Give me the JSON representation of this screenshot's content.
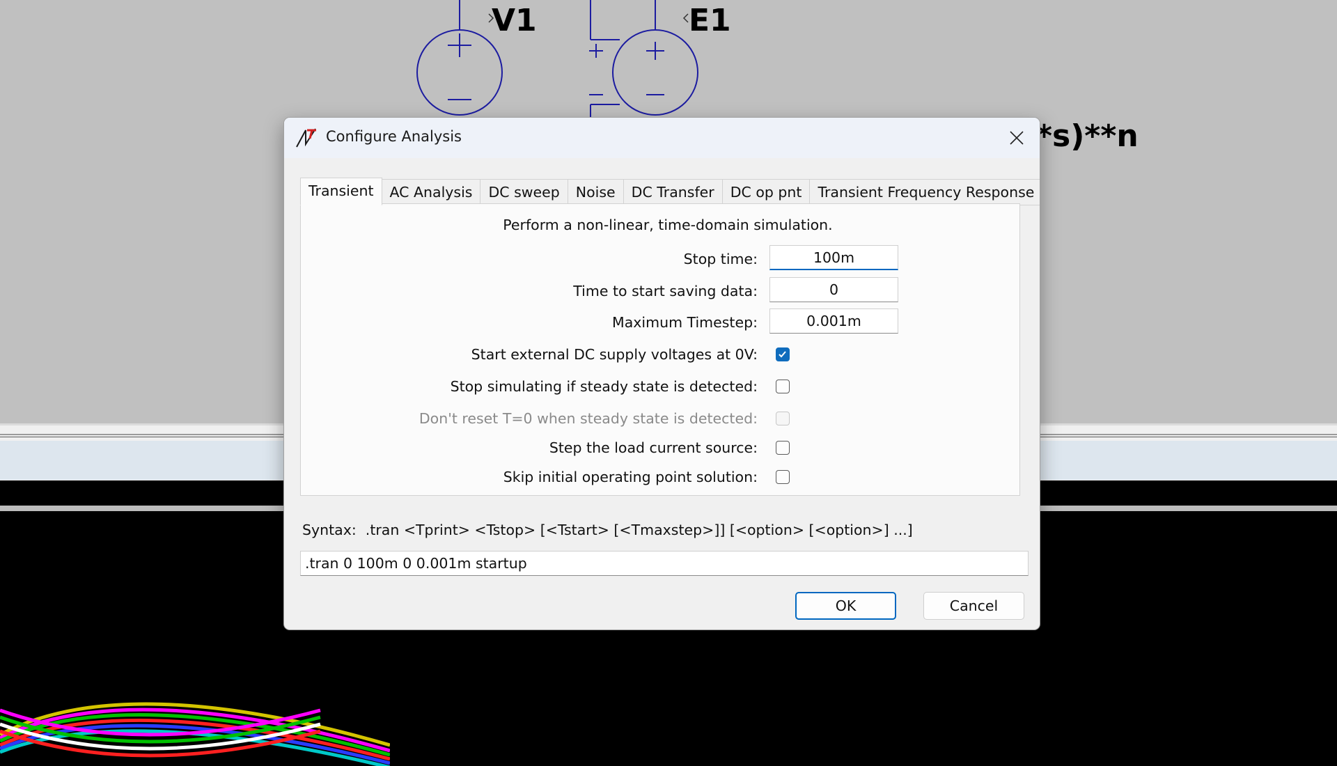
{
  "schematic": {
    "v1_label": "V1",
    "e1_label": "E1",
    "expr_fragment": "*s)**n"
  },
  "dialog": {
    "title": "Configure Analysis",
    "tabs": [
      {
        "label": "Transient"
      },
      {
        "label": "AC Analysis"
      },
      {
        "label": "DC sweep"
      },
      {
        "label": "Noise"
      },
      {
        "label": "DC Transfer"
      },
      {
        "label": "DC op pnt"
      },
      {
        "label": "Transient Frequency Response"
      }
    ],
    "active_tab": "Transient",
    "transient": {
      "description": "Perform a non-linear, time-domain simulation.",
      "stop_time_label": "Stop time:",
      "stop_time_value": "100m",
      "start_saving_label": "Time to start saving data:",
      "start_saving_value": "0",
      "max_timestep_label": "Maximum Timestep:",
      "max_timestep_value": "0.001m",
      "options": [
        {
          "label": "Start external DC supply voltages at 0V:",
          "checked": true,
          "enabled": true
        },
        {
          "label": "Stop simulating if steady state is detected:",
          "checked": false,
          "enabled": true
        },
        {
          "label": "Don't reset T=0 when steady state is detected:",
          "checked": false,
          "enabled": false
        },
        {
          "label": "Step the load current source:",
          "checked": false,
          "enabled": true
        },
        {
          "label": "Skip initial operating point solution:",
          "checked": false,
          "enabled": true
        }
      ]
    },
    "syntax": "Syntax:  .tran <Tprint> <Tstop> [<Tstart> [<Tmaxstep>]] [<option> [<option>] ...]",
    "command": ".tran 0 100m 0 0.001m startup",
    "ok_label": "OK",
    "cancel_label": "Cancel"
  },
  "colors": {
    "accent": "#0067c0",
    "annotation": "#ff0000",
    "schematic_wire": "#1c1ca0"
  }
}
